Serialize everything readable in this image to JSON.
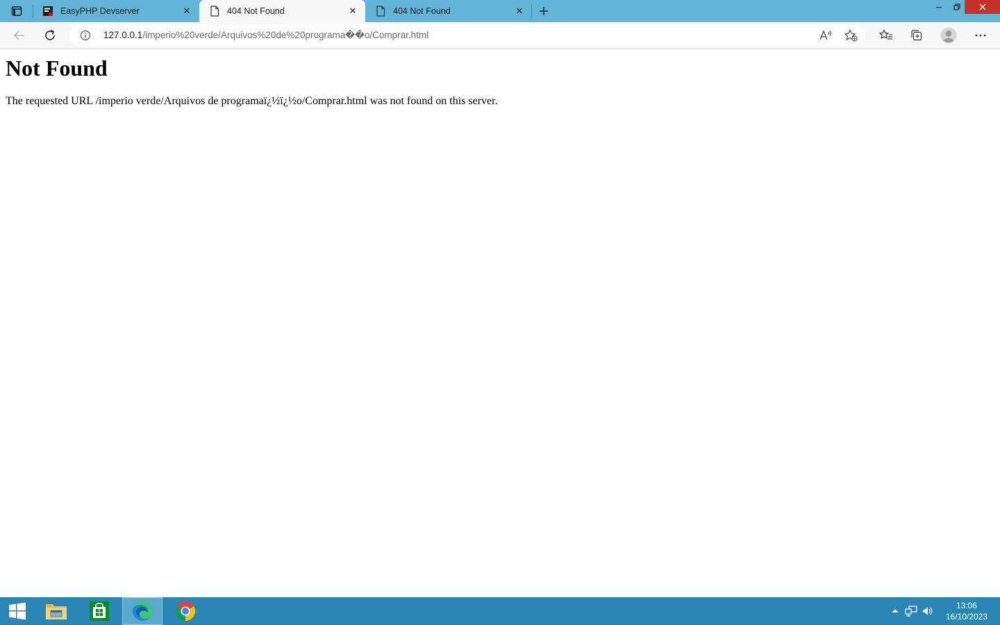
{
  "browser": {
    "tabs": [
      {
        "title": "EasyPHP Devserver",
        "active": false,
        "favicon": "easyphp-icon"
      },
      {
        "title": "404 Not Found",
        "active": true,
        "favicon": "page-icon"
      },
      {
        "title": "404 Not Found",
        "active": false,
        "favicon": "page-icon"
      }
    ],
    "close_glyph": "✕",
    "address": {
      "host": "127.0.0.1",
      "path": "/imperio%20verde/Arquivos%20de%20programa��o/Comprar.html"
    },
    "colors": {
      "tabstrip": "#63b5d8",
      "active_tab": "#f7f7f7",
      "window_close": "#c7312b"
    }
  },
  "page": {
    "heading": "Not Found",
    "message": "The requested URL /imperio verde/Arquivos de programaï¿½ï¿½o/Comprar.html was not found on this server."
  },
  "taskbar": {
    "items": [
      "windows-start-icon",
      "file-explorer-icon",
      "store-icon",
      "edge-icon",
      "chrome-icon"
    ],
    "active_item": "edge-icon",
    "clock": {
      "time": "13:06",
      "date": "16/10/2023"
    },
    "colors": {
      "background": "#2a86b2"
    }
  }
}
